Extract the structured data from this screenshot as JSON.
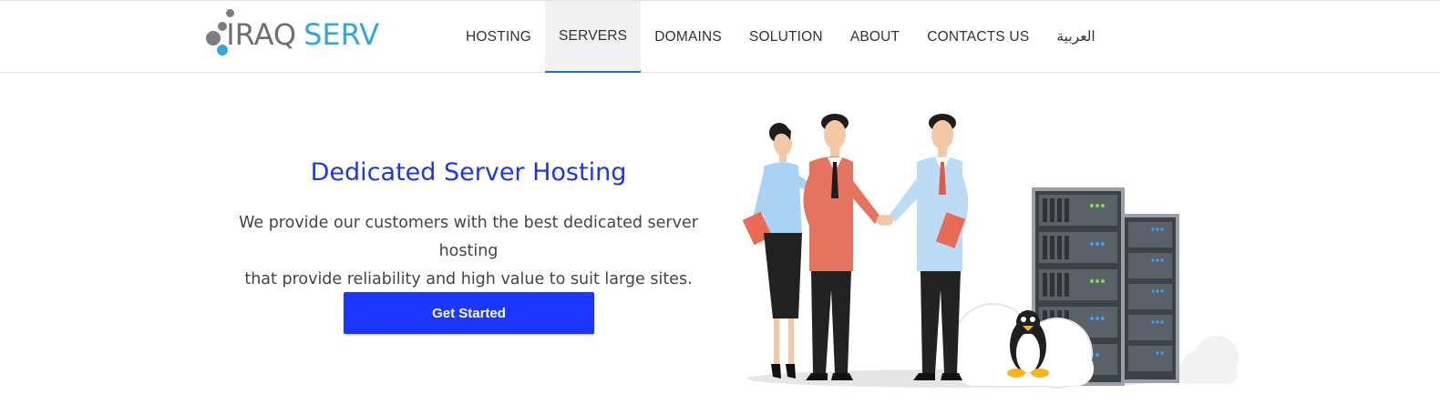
{
  "brand": {
    "word1": "IRAQ",
    "word2": "SERV"
  },
  "nav": {
    "items": [
      {
        "label": "HOSTING",
        "active": false
      },
      {
        "label": "SERVERS",
        "active": true
      },
      {
        "label": "DOMAINS",
        "active": false
      },
      {
        "label": "SOLUTION",
        "active": false
      },
      {
        "label": "ABOUT",
        "active": false
      },
      {
        "label": "CONTACTS US",
        "active": false
      },
      {
        "label": "العربية",
        "active": false
      }
    ]
  },
  "hero": {
    "title": "Dedicated Server Hosting",
    "description_line1": "We provide our customers with the best dedicated server hosting",
    "description_line2": "that provide reliability and high value to suit large sites.",
    "cta_label": "Get Started"
  },
  "colors": {
    "accent": "#1a36ff",
    "title": "#1a38e6",
    "logo_blue": "#34a6df",
    "logo_gray": "#6f6f6f",
    "nav_active_bg": "#f1f1f1",
    "nav_active_border": "#1f6fc0"
  },
  "illustration": {
    "icons": [
      "woman-figure",
      "businessman-figure",
      "client-figure",
      "server-rack",
      "linux-penguin",
      "cloud"
    ]
  }
}
